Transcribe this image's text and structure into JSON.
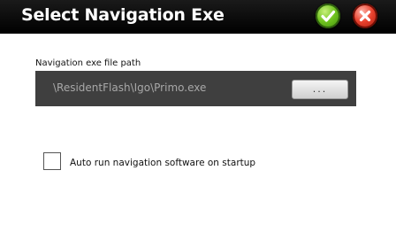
{
  "window": {
    "title": "Select Navigation Exe",
    "ok_icon": "check-icon",
    "close_icon": "close-icon",
    "ok_color": "#5cb21a",
    "close_color": "#d9321f"
  },
  "path_section": {
    "label": "Navigation exe file path",
    "value": "\\ResidentFlash\\Igo\\Primo.exe",
    "browse_label": "...",
    "field_color": "#3f3f3f"
  },
  "autorun": {
    "label": "Auto run navigation software on startup",
    "checked": false
  }
}
